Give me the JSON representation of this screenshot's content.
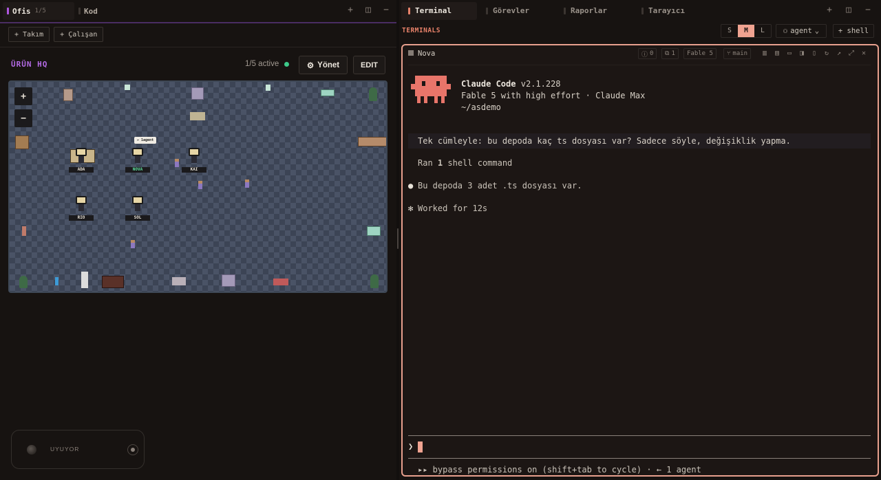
{
  "left": {
    "tabs": [
      {
        "label": "Ofis",
        "sub": "1/5"
      },
      {
        "label": "Kod"
      }
    ],
    "toolbar": {
      "team_label": "+ Takım",
      "employee_label": "+ Çalışan"
    },
    "office_title": "ÜRÜN HQ",
    "active_text": "1/5 active",
    "manage_label": "Yönet",
    "edit_label": "EDIT",
    "zoom_in": "+",
    "zoom_out": "−",
    "bubble": "← 1agent",
    "agents": [
      "ADA",
      "NOVA",
      "KAI",
      "RIO",
      "SOL"
    ],
    "sleep_label": "UYUYOR"
  },
  "right": {
    "tabs": [
      {
        "label": "Terminal"
      },
      {
        "label": "Görevler"
      },
      {
        "label": "Raporlar"
      },
      {
        "label": "Tarayıcı"
      }
    ],
    "terminals_title": "TERMINALS",
    "sizes": [
      "S",
      "M",
      "L"
    ],
    "size_selected": "M",
    "agent_select": "agent",
    "shell_label": "+ shell",
    "session": {
      "name": "Nova",
      "errors": "0",
      "copies": "1",
      "model": "Fable 5",
      "branch": "main"
    },
    "banner": {
      "app": "Claude Code",
      "version": "v2.1.228",
      "model_line": "Fable 5 with high effort · Claude Max",
      "path": "~/asdemo"
    },
    "prompt": "Tek cümleyle: bu depoda kaç ts dosyası var? Sadece söyle, değişiklik yapma.",
    "ran_pre": "Ran ",
    "ran_count": "1",
    "ran_post": " shell command",
    "answer_bullet": "●",
    "answer": "Bu depoda 3 adet .ts dosyası var.",
    "worked_bullet": "✻",
    "worked": "Worked for 12s",
    "caret": "❯",
    "status": "▸▸ bypass permissions on (shift+tab to cycle) · ← 1 agent"
  },
  "colors": {
    "accent_left": "#b057e0",
    "accent_right": "#e8826a",
    "active_dot": "#3dc98a",
    "mascot": "#e8756a"
  }
}
